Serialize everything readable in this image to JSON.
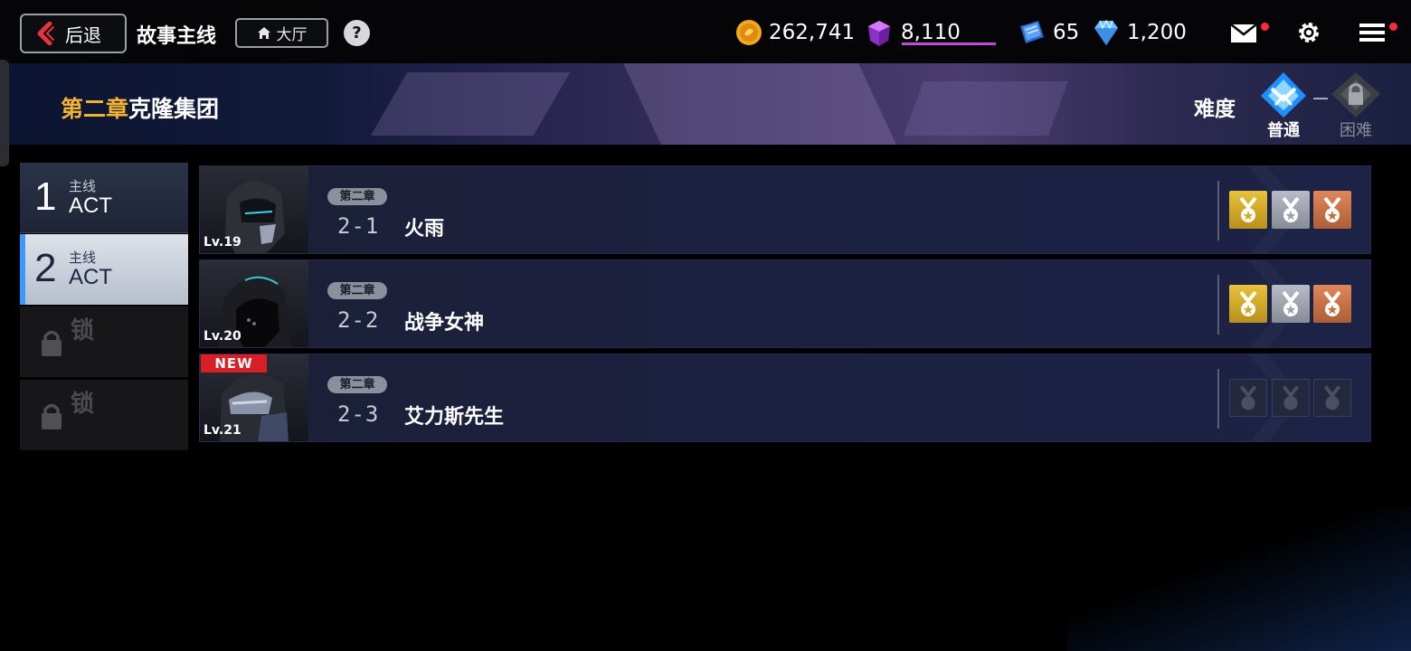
{
  "topbar": {
    "back_label": "后退",
    "title": "故事主线",
    "lobby_label": "大厅",
    "help_label": "?",
    "resources": [
      {
        "name": "gold-coin-icon",
        "value": "262,741",
        "color": "#f0a820"
      },
      {
        "name": "crystal-icon",
        "value": "8,110",
        "color": "#a23ccf"
      },
      {
        "name": "ticket-icon",
        "value": "65",
        "color": "#3a78d8"
      },
      {
        "name": "diamond-icon",
        "value": "1,200",
        "color": "#8ad0ff"
      }
    ],
    "mail_notification": true,
    "menu_notification": true
  },
  "banner": {
    "chapter_highlight": "第二章",
    "chapter_rest": "克隆集团",
    "difficulty_label": "难度",
    "difficulties": [
      {
        "label": "普通",
        "selected": true,
        "locked": false
      },
      {
        "label": "困难",
        "selected": false,
        "locked": true
      }
    ]
  },
  "acts": [
    {
      "number": "1",
      "sub": "主线",
      "act": "ACT",
      "state": "normal"
    },
    {
      "number": "2",
      "sub": "主线",
      "act": "ACT",
      "state": "selected"
    },
    {
      "locked_label": "锁",
      "state": "locked"
    },
    {
      "locked_label": "锁",
      "state": "locked"
    }
  ],
  "stages": [
    {
      "chapter": "第二章",
      "code": "2-1",
      "name": "火雨",
      "level": "Lv.19",
      "is_new": false,
      "medals": [
        "gold",
        "silver",
        "bronze"
      ]
    },
    {
      "chapter": "第二章",
      "code": "2-2",
      "name": "战争女神",
      "level": "Lv.20",
      "is_new": false,
      "medals": [
        "gold",
        "silver",
        "bronze"
      ]
    },
    {
      "chapter": "第二章",
      "code": "2-3",
      "name": "艾力斯先生",
      "level": "Lv.21",
      "is_new": true,
      "new_label": "NEW",
      "medals": [
        "empty",
        "empty",
        "empty"
      ]
    }
  ],
  "colors": {
    "accent_gold": "#f2b332",
    "selected_blue": "#3b98ff",
    "new_red": "#d81f26",
    "notify_red": "#ff2a3a"
  }
}
